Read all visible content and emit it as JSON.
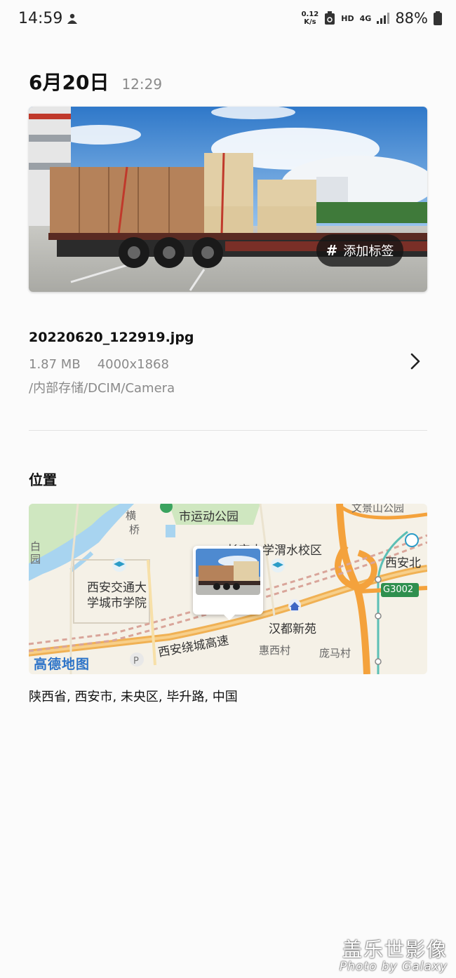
{
  "status_bar": {
    "time": "14:59",
    "net_speed_value": "0.12",
    "net_speed_unit": "K/s",
    "hd": "HD",
    "network": "4G",
    "battery": "88%"
  },
  "header": {
    "date": "6月20日",
    "time": "12:29"
  },
  "photo": {
    "tag_button_label": "添加标签",
    "tag_icon": "#"
  },
  "file": {
    "name": "20220620_122919.jpg",
    "size": "1.87 MB",
    "resolution": "4000x1868",
    "path": "/内部存储/DCIM/Camera"
  },
  "location": {
    "section_title": "位置",
    "address": "陕西省, 西安市, 未央区, 毕升路, 中国",
    "map": {
      "brand": "高德地图",
      "labels": {
        "park": "市运动公园",
        "heng": "横",
        "qiao": "桥",
        "bai": "白",
        "yuan": "园",
        "chang_an_uni": "长安大学渭水校区",
        "xjtu_line1": "西安交通大",
        "xjtu_line2": "学城市学院",
        "xian_bei": "西安北",
        "g3002": "G3002",
        "handu": "汉都新苑",
        "ring_express": "西安绕城高速",
        "huixi": "惠西村",
        "pangma": "庞马村",
        "top_right": "文景山公园"
      }
    }
  },
  "watermark": {
    "line1": "盖乐世影像",
    "line2": "Photo by Galaxy"
  },
  "colors": {
    "accent_map_road": "#f4a23c",
    "map_base": "#f5f1e7",
    "text_secondary": "#8a8a8a"
  }
}
